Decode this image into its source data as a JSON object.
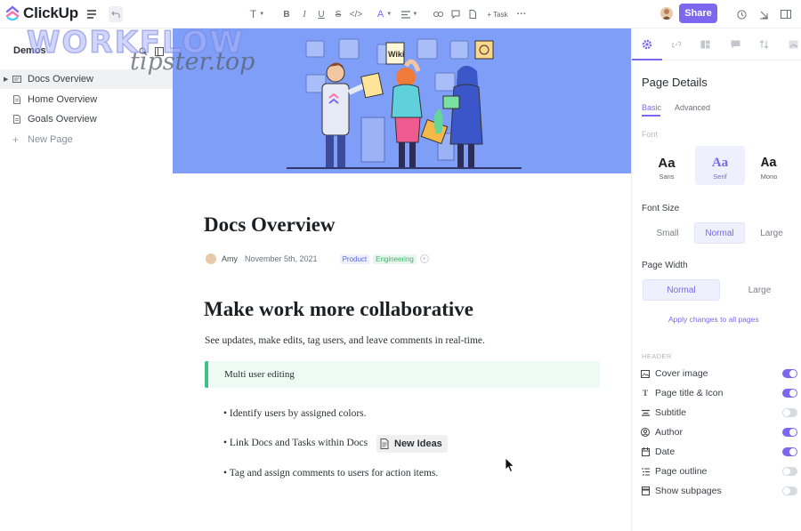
{
  "app": {
    "brand": "ClickUp"
  },
  "toolbar": {
    "task_label": "+ Task",
    "share_label": "Share"
  },
  "watermark": {
    "line1": "WORKFLOW",
    "line2": "tipster.top"
  },
  "sidebar": {
    "title": "Demos",
    "items": [
      {
        "label": "Docs Overview",
        "active": true
      },
      {
        "label": "Home Overview",
        "active": false
      },
      {
        "label": "Goals Overview",
        "active": false
      }
    ],
    "new_page_label": "New Page"
  },
  "doc": {
    "title": "Docs Overview",
    "author": "Amy",
    "date": "November 5th, 2021",
    "tags": [
      {
        "label": "Product",
        "color": "#5b6bd6"
      },
      {
        "label": "Engineering",
        "color": "#3bb56a"
      }
    ],
    "heading": "Make work more collaborative",
    "paragraph": "See updates, make edits, tag users, and leave comments in real-time.",
    "callout": "Multi user editing",
    "bullets": [
      "• Identify users by assigned colors.",
      "• Link Docs and Tasks within Docs",
      "• Tag and assign comments to users for action items."
    ],
    "linked_doc": "New Ideas"
  },
  "panel": {
    "title": "Page Details",
    "tabs": {
      "basic": "Basic",
      "advanced": "Advanced"
    },
    "font_label": "Font",
    "fonts": [
      {
        "sample": "Aa",
        "name": "Sans",
        "selected": false
      },
      {
        "sample": "Aa",
        "name": "Serif",
        "selected": true
      },
      {
        "sample": "Aa",
        "name": "Mono",
        "selected": false
      }
    ],
    "font_size_label": "Font Size",
    "font_sizes": [
      "Small",
      "Normal",
      "Large"
    ],
    "font_size_selected": "Normal",
    "page_width_label": "Page Width",
    "page_widths": [
      "Normal",
      "Large"
    ],
    "page_width_selected": "Normal",
    "apply_label": "Apply changes to all pages",
    "header_section": "HEADER",
    "toggles": [
      {
        "label": "Cover image",
        "icon": "image-icon",
        "on": true
      },
      {
        "label": "Page title & Icon",
        "icon": "title-icon",
        "on": true
      },
      {
        "label": "Subtitle",
        "icon": "subtitle-icon",
        "on": false
      },
      {
        "label": "Author",
        "icon": "user-icon",
        "on": true
      },
      {
        "label": "Date",
        "icon": "calendar-icon",
        "on": true
      },
      {
        "label": "Page outline",
        "icon": "outline-icon",
        "on": false
      },
      {
        "label": "Show subpages",
        "icon": "subpages-icon",
        "on": false
      }
    ]
  },
  "colors": {
    "accent": "#7b68ee",
    "cover": "#7f9ef7",
    "callout": "#3fc08a"
  }
}
